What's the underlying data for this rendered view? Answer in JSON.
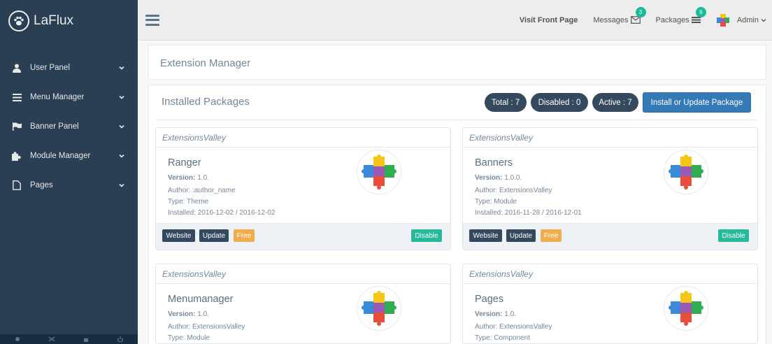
{
  "brand": {
    "title": "LaFlux",
    "icon": "paw-icon"
  },
  "sidebar": {
    "items": [
      {
        "label": "User Panel",
        "icon": "user-icon"
      },
      {
        "label": "Menu Manager",
        "icon": "bars-icon"
      },
      {
        "label": "Banner Panel",
        "icon": "flag-icon"
      },
      {
        "label": "Module Manager",
        "icon": "puzzle-icon"
      },
      {
        "label": "Pages",
        "icon": "file-icon"
      }
    ]
  },
  "topbar": {
    "visit": "Visit Front Page",
    "messages": {
      "label": "Messages",
      "count": "3"
    },
    "packages": {
      "label": "Packages",
      "count": "6"
    },
    "user": "Admin"
  },
  "header": {
    "title": "Extension Manager"
  },
  "main": {
    "title": "Installed Packages",
    "stats": {
      "total": "Total : 7",
      "disabled": "Disabled : 0",
      "active": "Active : 7"
    },
    "install_button": "Install or Update Package"
  },
  "labels": {
    "version": "Version:",
    "website": "Website",
    "update": "Update",
    "free": "Free",
    "disable": "Disable"
  },
  "packages": [
    {
      "vendor": "ExtensionsValley",
      "name": "Ranger",
      "version": "1.0.",
      "author": "Author: :author_name",
      "type": "Type: Theme",
      "installed": "Installed: 2016-12-02 / 2016-12-02"
    },
    {
      "vendor": "ExtensionsValley",
      "name": "Banners",
      "version": "1.0.0.",
      "author": "Author: ExtensionsValley",
      "type": "Type: Module",
      "installed": "Installed: 2016-11-28 / 2016-12-01"
    },
    {
      "vendor": "ExtensionsValley",
      "name": "Menumanager",
      "version": "1.0.",
      "author": "Author: ExtensionsValley",
      "type": "Type: Module",
      "installed": ""
    },
    {
      "vendor": "ExtensionsValley",
      "name": "Pages",
      "version": "1.0.",
      "author": "Author: ExtensionsValley",
      "type": "Type: Component",
      "installed": ""
    }
  ],
  "colors": {
    "sidebar": "#2a3f54",
    "accent_green": "#26b99a",
    "badge": "#1abb9c",
    "primary": "#337ab7",
    "dark_button": "#34495e",
    "free": "#f0ad4e"
  }
}
